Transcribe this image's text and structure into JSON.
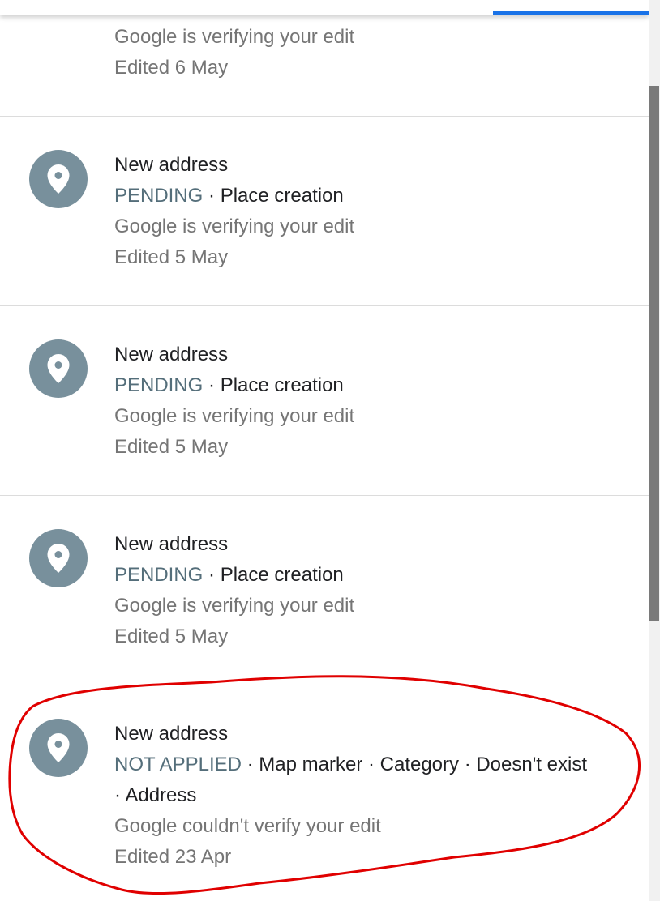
{
  "items": [
    {
      "sub1": "Google is verifying your edit",
      "sub2": "Edited 6 May"
    },
    {
      "title": "New address",
      "status": "PENDING",
      "detail": " · Place creation",
      "sub1": "Google is verifying your edit",
      "sub2": "Edited 5 May",
      "icon": "map-pin-icon"
    },
    {
      "title": "New address",
      "status": "PENDING",
      "detail": " · Place creation",
      "sub1": "Google is verifying your edit",
      "sub2": "Edited 5 May",
      "icon": "map-pin-icon"
    },
    {
      "title": "New address",
      "status": "PENDING",
      "detail": " · Place creation",
      "sub1": "Google is verifying your edit",
      "sub2": "Edited 5 May",
      "icon": "map-pin-icon"
    },
    {
      "title": "New address",
      "status": "NOT APPLIED",
      "detail": " · Map marker · Category · Doesn't exist",
      "detail2": "· Address",
      "sub1": "Google couldn't verify your edit",
      "sub2": "Edited 23 Apr",
      "icon": "map-pin-icon"
    }
  ],
  "colors": {
    "status": "#546e7a",
    "icon_bg": "#78909c",
    "annotation": "#e00000",
    "tab_indicator": "#1a73e8"
  }
}
